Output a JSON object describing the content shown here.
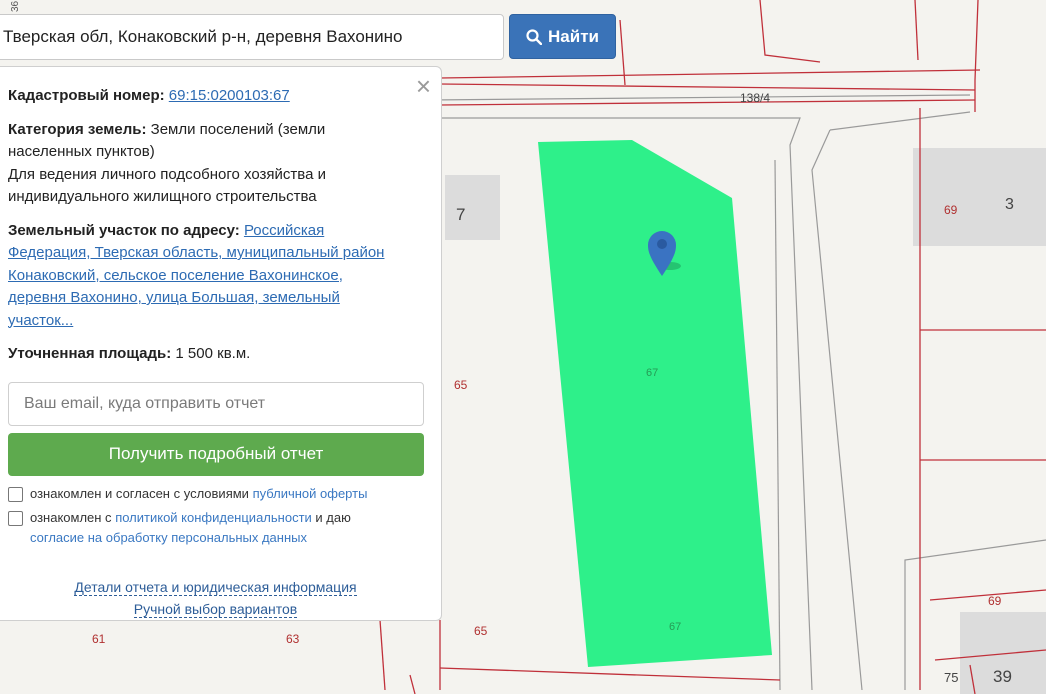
{
  "search": {
    "value": "Тверская обл, Конаковский р-н, деревня Вахонино",
    "button_label": "Найти"
  },
  "map": {
    "labels": {
      "road_138_4": "138/4",
      "plot_7": "7",
      "plot_69_a": "69",
      "plot_3": "3",
      "plot_65_a": "65",
      "plot_67_a": "67",
      "plot_65_b": "65",
      "plot_67_b": "67",
      "plot_61": "61",
      "plot_63": "63",
      "plot_69_b": "69",
      "plot_75": "75",
      "plot_39": "39",
      "corner_left_top": "36"
    },
    "colors": {
      "parcel_fill": "#2ef08a",
      "boundary": "#c0303a",
      "marker": "#3a73c2"
    }
  },
  "panel": {
    "cadastral_label": "Кадастровый номер:",
    "cadastral_value": "69:15:0200103:67",
    "category_label": "Категория земель:",
    "category_value_1": "Земли поселений (земли",
    "category_value_2": "населенных пунктов)",
    "usage_1": "Для ведения личного подсобного хозяйства и",
    "usage_2": "индивидуального жилищного строительства",
    "address_label": "Земельный участок по адресу:",
    "address_1": "Российская",
    "address_2": "Федерация, Тверская область, муниципальный район",
    "address_3": "Конаковский, сельское поселение Вахонинское,",
    "address_4": "деревня Вахонино, улица Большая, земельный",
    "address_5": "участок...",
    "area_label": "Уточненная площадь:",
    "area_value": "1 500 кв.м.",
    "email_placeholder": "Ваш email, куда отправить отчет",
    "get_report_label": "Получить подробный отчет",
    "consent1_prefix": "ознакомлен и согласен с условиями",
    "consent1_link": "публичной оферты",
    "consent2_prefix": "ознакомлен с",
    "consent2_link": "политикой конфиденциальности",
    "consent2_mid": "и даю",
    "consent2_link2": "согласие на обработку персональных данных",
    "details_link": "Детали отчета и юридическая информация",
    "manual_link": "Ручной выбор вариантов",
    "close_symbol": "×"
  }
}
